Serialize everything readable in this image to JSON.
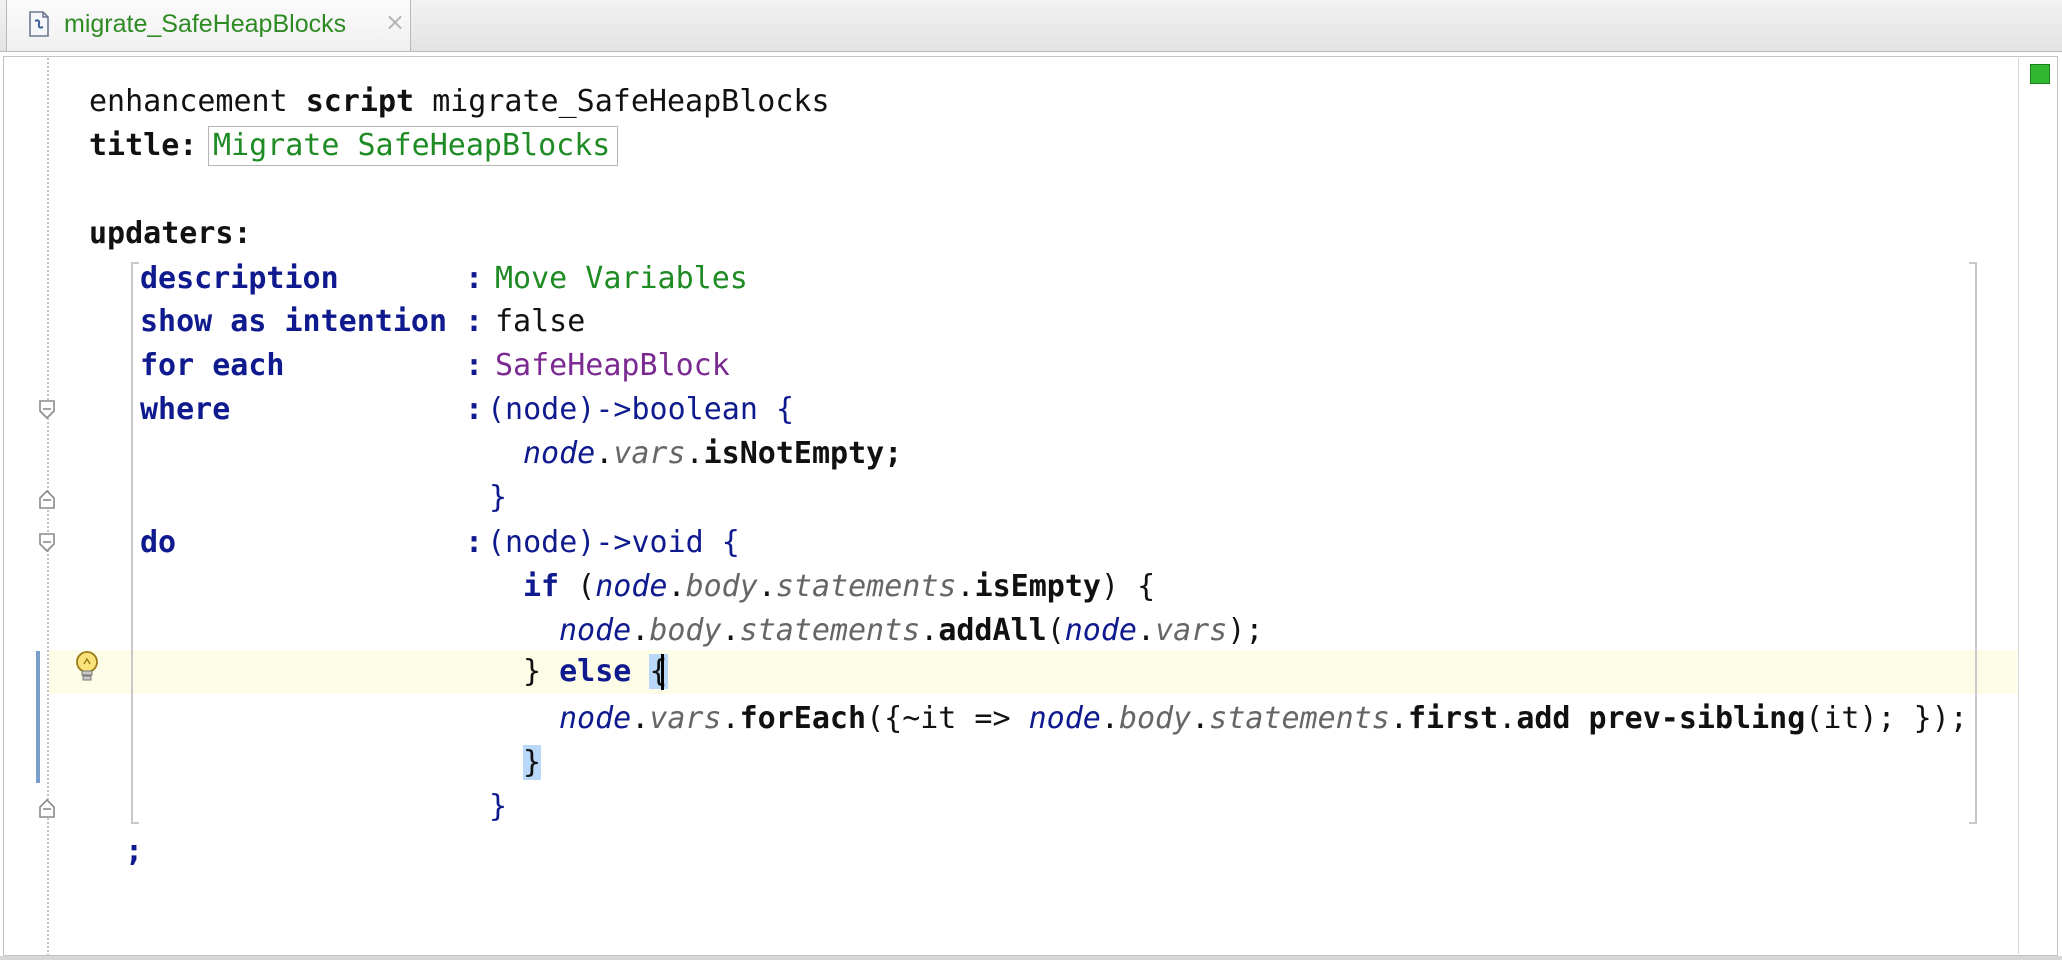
{
  "tab": {
    "title": "migrate_SafeHeapBlocks",
    "close_glyph": "×",
    "icon": "script-file-icon"
  },
  "editor": {
    "status_color": "#30b830",
    "line1": {
      "kw1": "enhancement",
      "kw2": "script",
      "name": "migrate_SafeHeapBlocks"
    },
    "title": {
      "label": "title:",
      "value": "Migrate SafeHeapBlocks"
    },
    "updaters_label": "updaters:",
    "description": {
      "key": "description",
      "sep": ":",
      "value": "Move Variables"
    },
    "show_as_intention": {
      "key": "show as intention",
      "sep": ":",
      "value": "false"
    },
    "for_each": {
      "key": "for each",
      "sep": ":",
      "value": "SafeHeapBlock"
    },
    "where": {
      "key": "where",
      "sep": ":",
      "sig_open": "(node)->",
      "sig_type": "boolean",
      "sig_brace": " {",
      "body": {
        "node": "node",
        "dot1": ".",
        "vars": "vars",
        "dot2": ".",
        "op": "isNotEmpty",
        "semi": ";"
      },
      "close": "}"
    },
    "do": {
      "key": "do",
      "sep": ":",
      "sig_open": "(node)->",
      "sig_type": "void",
      "sig_brace": " {",
      "if_line": {
        "kw": "if",
        "paren": " (",
        "node": "node",
        "d1": ".",
        "body": "body",
        "d2": ".",
        "statements": "statements",
        "d3": ".",
        "op": "isEmpty",
        "end": ") {"
      },
      "add_line": {
        "node": "node",
        "d1": ".",
        "body": "body",
        "d2": ".",
        "statements": "statements",
        "d3": ".",
        "op": "addAll",
        "open": "(",
        "node2": "node",
        "d4": ".",
        "vars": "vars",
        "end": ");"
      },
      "else_line": {
        "close": "} ",
        "kw": "else",
        "sp": " ",
        "brace": "{"
      },
      "foreach_line": {
        "node": "node",
        "d1": ".",
        "vars": "vars",
        "d2": ".",
        "op": "forEach",
        "open": "({",
        "tilde": "~it =>",
        "sp": " ",
        "node2": "node",
        "d3": ".",
        "body": "body",
        "d4": ".",
        "statements": "statements",
        "d5": ".",
        "first": "first",
        "d6": ".",
        "add": "add prev-sibling",
        "end": "(it); });"
      },
      "inner_close": "}",
      "close": "}"
    },
    "terminator": ";"
  }
}
